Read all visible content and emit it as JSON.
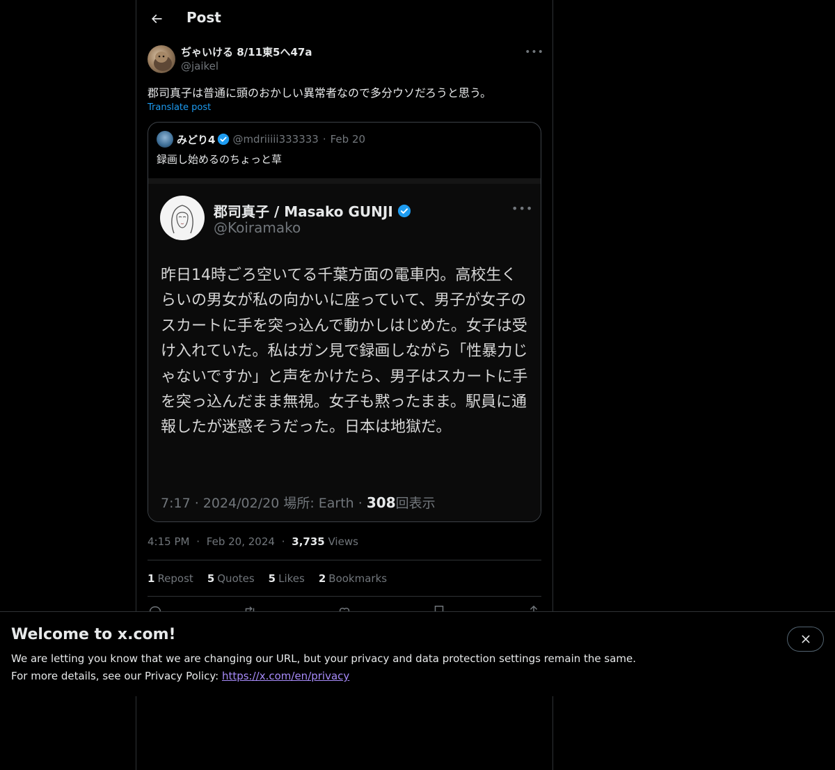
{
  "header": {
    "title": "Post"
  },
  "post": {
    "author_name": "ぢゃいける 8/11東5へ47a",
    "author_handle": "@jaikel",
    "text": "郡司真子は普通に頭のおかしい異常者なので多分ウソだろうと思う。",
    "translate_label": "Translate post",
    "time": "4:15 PM",
    "date": "Feb 20, 2024",
    "views_count": "3,735",
    "views_label": "Views",
    "sep": "·"
  },
  "quote": {
    "name": "みどり4",
    "handle": "@mdriiiii333333",
    "sep": "·",
    "date": "Feb 20",
    "text": "録画し始めるのちょっと草"
  },
  "embedded": {
    "name": "郡司真子 / Masako GUNJI",
    "handle": "@Koiramako",
    "text": "昨日14時ごろ空いてる千葉方面の電車内。高校生くらいの男女が私の向かいに座っていて、男子が女子のスカートに手を突っ込んで動かしはじめた。女子は受け入れていた。私はガン見で録画しながら「性暴力じゃないですか」と声をかけたら、男子はスカートに手を突っ込んだまま無視。女子も黙ったまま。駅員に通報したが迷惑そうだった。日本は地獄だ。",
    "footer_meta": "7:17 · 2024/02/20 場所: Earth · ",
    "footer_views": "308",
    "footer_views_label": "回表示"
  },
  "stats": [
    {
      "count": "1",
      "label": "Repost"
    },
    {
      "count": "5",
      "label": "Quotes"
    },
    {
      "count": "5",
      "label": "Likes"
    },
    {
      "count": "2",
      "label": "Bookmarks"
    }
  ],
  "banner": {
    "title": "Welcome to x.com!",
    "line1": "We are letting you know that we are changing our URL, but your privacy and data protection settings remain the same.",
    "line2_prefix": "For more details, see our Privacy Policy: ",
    "link": "https://x.com/en/privacy"
  },
  "icons": {
    "back": "arrow-left-icon",
    "more": "more-horizontal-icon",
    "verified": "verified-badge-icon",
    "close": "close-icon",
    "reply": "reply-icon",
    "repost": "repost-icon",
    "like": "heart-icon",
    "bookmark": "bookmark-icon",
    "share": "share-icon"
  },
  "colors": {
    "background": "#000000",
    "accent": "#1d9bf0",
    "secondary_text": "#71767b",
    "link": "#a78bfa"
  }
}
